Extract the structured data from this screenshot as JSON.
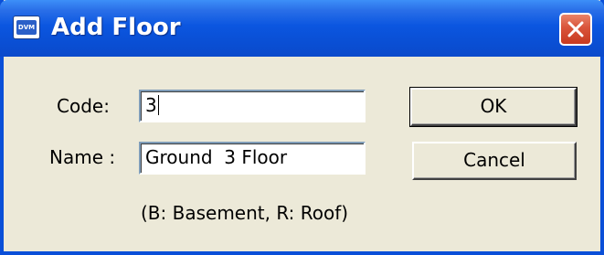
{
  "window": {
    "title": "Add Floor",
    "icon": "app-icon",
    "icon_text": "DVM"
  },
  "form": {
    "code_label": "Code:",
    "code_value": "3",
    "name_label": "Name :",
    "name_value": "Ground  3 Floor",
    "hint": "(B: Basement, R: Roof)"
  },
  "buttons": {
    "ok_label": "OK",
    "cancel_label": "Cancel"
  },
  "colors": {
    "titlebar": "#0a50d6",
    "close_button": "#d9543a",
    "dialog_face": "#ece9d8"
  }
}
